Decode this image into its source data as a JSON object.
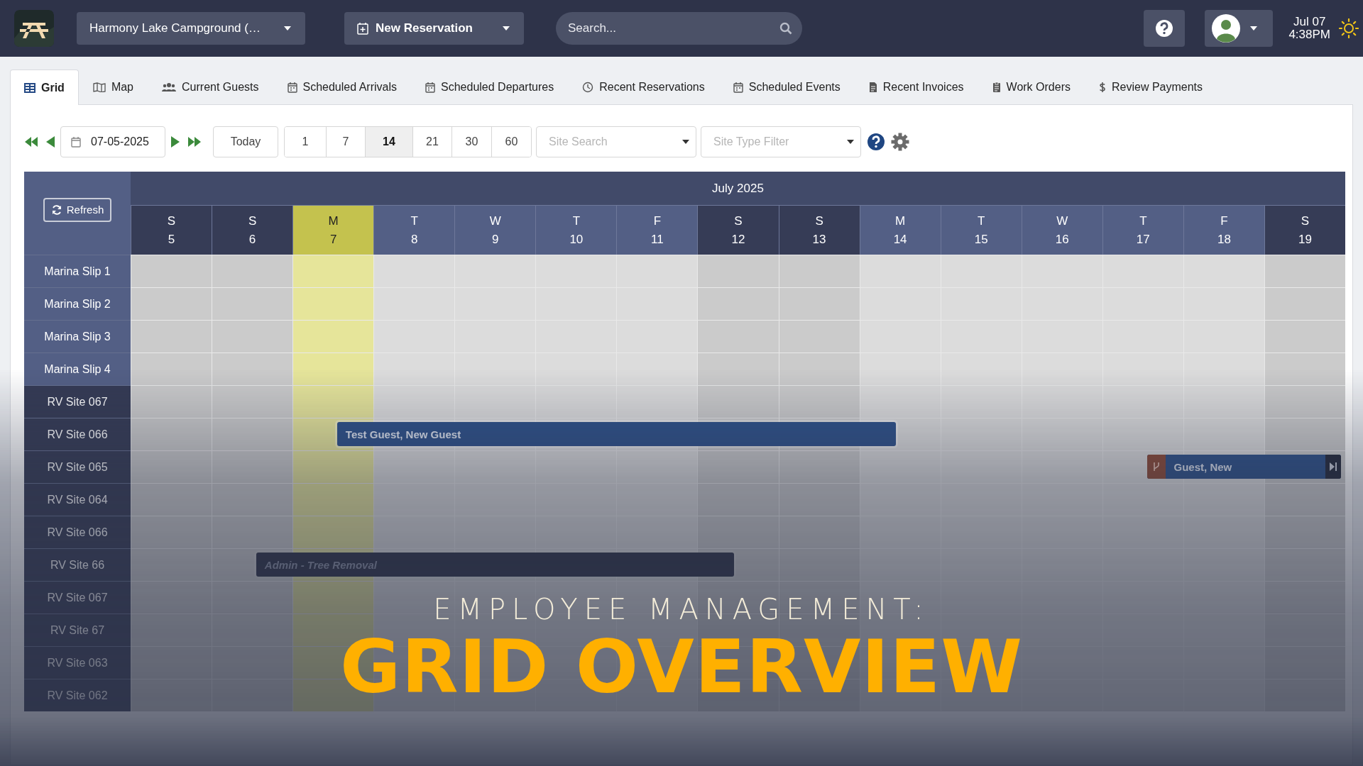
{
  "topbar": {
    "campground": "Harmony Lake Campground (…",
    "new_reservation": "New Reservation",
    "search": {
      "placeholder": "Search..."
    },
    "date": "Jul 07",
    "time": "4:38PM"
  },
  "tabs": [
    {
      "label": "Grid",
      "selected": true
    },
    {
      "label": "Map",
      "selected": false
    },
    {
      "label": "Current Guests",
      "selected": false
    },
    {
      "label": "Scheduled Arrivals",
      "selected": false
    },
    {
      "label": "Scheduled Departures",
      "selected": false
    },
    {
      "label": "Recent Reservations",
      "selected": false
    },
    {
      "label": "Scheduled Events",
      "selected": false
    },
    {
      "label": "Recent Invoices",
      "selected": false
    },
    {
      "label": "Work Orders",
      "selected": false
    },
    {
      "label": "Review Payments",
      "selected": false
    }
  ],
  "toolbar": {
    "date": "07-05-2025",
    "today": "Today",
    "ranges": [
      {
        "label": "1",
        "selected": false
      },
      {
        "label": "7",
        "selected": false
      },
      {
        "label": "14",
        "selected": true
      },
      {
        "label": "21",
        "selected": false
      },
      {
        "label": "30",
        "selected": false
      },
      {
        "label": "60",
        "selected": false
      }
    ],
    "site_search": {
      "placeholder": "Site Search"
    },
    "site_type_filter": {
      "placeholder": "Site Type Filter"
    }
  },
  "grid": {
    "refresh": "Refresh",
    "month": "July 2025",
    "days": [
      {
        "weekday": "S",
        "day": "5",
        "weekend": true,
        "today": false
      },
      {
        "weekday": "S",
        "day": "6",
        "weekend": true,
        "today": false
      },
      {
        "weekday": "M",
        "day": "7",
        "weekend": false,
        "today": true
      },
      {
        "weekday": "T",
        "day": "8",
        "weekend": false,
        "today": false
      },
      {
        "weekday": "W",
        "day": "9",
        "weekend": false,
        "today": false
      },
      {
        "weekday": "T",
        "day": "10",
        "weekend": false,
        "today": false
      },
      {
        "weekday": "F",
        "day": "11",
        "weekend": false,
        "today": false
      },
      {
        "weekday": "S",
        "day": "12",
        "weekend": true,
        "today": false
      },
      {
        "weekday": "S",
        "day": "13",
        "weekend": true,
        "today": false
      },
      {
        "weekday": "M",
        "day": "14",
        "weekend": false,
        "today": false
      },
      {
        "weekday": "T",
        "day": "15",
        "weekend": false,
        "today": false
      },
      {
        "weekday": "W",
        "day": "16",
        "weekend": false,
        "today": false
      },
      {
        "weekday": "T",
        "day": "17",
        "weekend": false,
        "today": false
      },
      {
        "weekday": "F",
        "day": "18",
        "weekend": false,
        "today": false
      },
      {
        "weekday": "S",
        "day": "19",
        "weekend": true,
        "today": false
      }
    ],
    "sites": [
      {
        "name": "Marina Slip 1",
        "kind": "marina"
      },
      {
        "name": "Marina Slip 2",
        "kind": "marina"
      },
      {
        "name": "Marina Slip 3",
        "kind": "marina"
      },
      {
        "name": "Marina Slip 4",
        "kind": "marina"
      },
      {
        "name": "RV Site 067",
        "kind": "rv"
      },
      {
        "name": "RV Site 066",
        "kind": "rv",
        "bookings": [
          {
            "label": "Test Guest, New Guest",
            "kind": "reservation",
            "continues": false
          }
        ]
      },
      {
        "name": "RV Site 065",
        "kind": "rv",
        "bookings": [
          {
            "label": "Guest, New",
            "kind": "split",
            "continues": true
          }
        ]
      },
      {
        "name": "RV Site 064",
        "kind": "rv"
      },
      {
        "name": "RV Site 066",
        "kind": "rv"
      },
      {
        "name": "RV Site 66",
        "kind": "rv",
        "bookings": [
          {
            "label": "Admin - Tree Removal",
            "kind": "maintenance",
            "continues": false
          }
        ]
      },
      {
        "name": "RV Site 067",
        "kind": "rv"
      },
      {
        "name": "RV Site 67",
        "kind": "rv"
      },
      {
        "name": "RV Site 063",
        "kind": "rv"
      },
      {
        "name": "RV Site 062",
        "kind": "rv"
      }
    ]
  },
  "overlay_title": {
    "subtitle": "EMPLOYEE MANAGEMENT:",
    "title": "GRID OVERVIEW"
  }
}
